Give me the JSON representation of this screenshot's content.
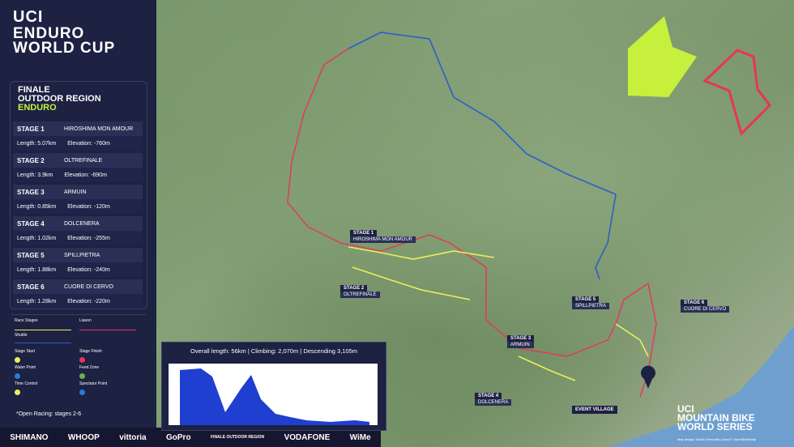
{
  "logo": {
    "uci": "UCI",
    "line1": "ENDURO",
    "line2": "WORLD CUP"
  },
  "region": {
    "line1": "FINALE",
    "line2": "OUTDOOR REGION",
    "line3": "ENDURO"
  },
  "stages": [
    {
      "num": "STAGE 1",
      "name": "HIROSHIMA MON AMOUR",
      "length": "Length: 5.07km",
      "elevation": "Elevation: -760m"
    },
    {
      "num": "STAGE 2",
      "name": "OLTREFINALE",
      "length": "Length: 3.9km",
      "elevation": "Elevation: -690m"
    },
    {
      "num": "STAGE 3",
      "name": "ARMUIN",
      "length": "Length: 0.85km",
      "elevation": "Elevation: -120m"
    },
    {
      "num": "STAGE 4",
      "name": "DOLCENERA",
      "length": "Length: 1.02km",
      "elevation": "Elevation: -255m"
    },
    {
      "num": "STAGE 5",
      "name": "SPILLPIETRA",
      "length": "Length: 1.88km",
      "elevation": "Elevation: -240m"
    },
    {
      "num": "STAGE 6",
      "name": "CUORE DI CERVO",
      "length": "Length: 1.28km",
      "elevation": "Elevation: -220m"
    }
  ],
  "legend": {
    "race_stages": "Race Stages",
    "liason": "Liason",
    "shuttle": "Shuttle",
    "stage_start": "Stage Start",
    "stage_finish": "Stage Finish",
    "water_point": "Water Point",
    "feed_zone": "Feed Zone",
    "time_control": "Time Control",
    "spectator_point": "Spectator Point"
  },
  "open_racing": "*Open Racing: stages 2-6",
  "sponsors": [
    "SHIMANO",
    "WHOOP",
    "vittoria",
    "GoPro",
    "FINALE OUTDOOR REGION",
    "VODAFONE",
    "WiMe"
  ],
  "elevation_profile": {
    "stats": "Overall length: 56km  |  Climbing: 2,070m  |  Descending 3,105m"
  },
  "map_labels": {
    "stage1": {
      "t": "STAGE 1",
      "n": "HIROSHIMA MON AMOUR"
    },
    "stage2": {
      "t": "STAGE 2",
      "n": "OLTREFINALE"
    },
    "stage3": {
      "t": "STAGE 3",
      "n": "ARMUIN"
    },
    "stage4": {
      "t": "STAGE 4",
      "n": "DOLCENERA"
    },
    "stage5": {
      "t": "STAGE 5",
      "n": "SPILLPIETRA"
    },
    "stage6": {
      "t": "STAGE 6",
      "n": "CUORE DI CERVO"
    },
    "event_village": "EVENT VILLAGE"
  },
  "mtb": {
    "uci": "UCI",
    "line1": "MOUNTAIN BIKE",
    "line2": "WORLD SERIES"
  },
  "credit": "Map design: Studio Simonetti | Data © OpenStreetMap",
  "colors": {
    "race": "#e9f05a",
    "liason": "#e8345a",
    "shuttle": "#2b5fc9",
    "brand_lime": "#c6f03c",
    "brand_red": "#e8345a"
  }
}
